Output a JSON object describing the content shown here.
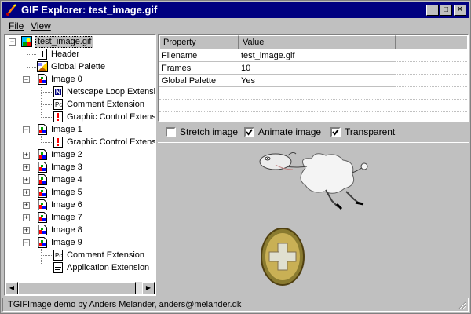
{
  "window": {
    "title": "GIF Explorer: test_image.gif"
  },
  "menu": [
    {
      "label": "File",
      "accel": "F"
    },
    {
      "label": "View",
      "accel": "V"
    }
  ],
  "tree": {
    "items": [
      {
        "label": "test_image.gif",
        "icon": "gif-file-icon",
        "expander": "−",
        "selected": true
      },
      {
        "label": "Header",
        "icon": "info-icon"
      },
      {
        "label": "Global Palette",
        "icon": "palette-icon"
      },
      {
        "label": "Image 0",
        "icon": "image-icon",
        "expander": "−"
      },
      {
        "label": "Netscape Loop Extension",
        "icon": "netscape-icon"
      },
      {
        "label": "Comment Extension",
        "icon": "comment-icon"
      },
      {
        "label": "Graphic Control Extension",
        "icon": "graphic-control-icon"
      },
      {
        "label": "Image 1",
        "icon": "image-icon",
        "expander": "−"
      },
      {
        "label": "Graphic Control Extension",
        "icon": "graphic-control-icon"
      },
      {
        "label": "Image 2",
        "icon": "image-icon",
        "expander": "+"
      },
      {
        "label": "Image 3",
        "icon": "image-icon",
        "expander": "+"
      },
      {
        "label": "Image 4",
        "icon": "image-icon",
        "expander": "+"
      },
      {
        "label": "Image 5",
        "icon": "image-icon",
        "expander": "+"
      },
      {
        "label": "Image 6",
        "icon": "image-icon",
        "expander": "+"
      },
      {
        "label": "Image 7",
        "icon": "image-icon",
        "expander": "+"
      },
      {
        "label": "Image 8",
        "icon": "image-icon",
        "expander": "+"
      },
      {
        "label": "Image 9",
        "icon": "image-icon",
        "expander": "−"
      },
      {
        "label": "Comment Extension",
        "icon": "comment-icon"
      },
      {
        "label": "Application Extension",
        "icon": "application-icon"
      }
    ]
  },
  "properties": {
    "columns": [
      "Property",
      "Value"
    ],
    "rows": [
      {
        "property": "Filename",
        "value": "test_image.gif"
      },
      {
        "property": "Frames",
        "value": "10"
      },
      {
        "property": "Global Palette",
        "value": "Yes"
      }
    ]
  },
  "options": [
    {
      "label": "Stretch image",
      "checked": false
    },
    {
      "label": "Animate image",
      "checked": true
    },
    {
      "label": "Transparent",
      "checked": true
    }
  ],
  "status": {
    "text": "TGIFImage demo by Anders Melander, anders@melander.dk"
  },
  "colors": {
    "titlebar": "#000080",
    "face": "#c0c0c0"
  }
}
